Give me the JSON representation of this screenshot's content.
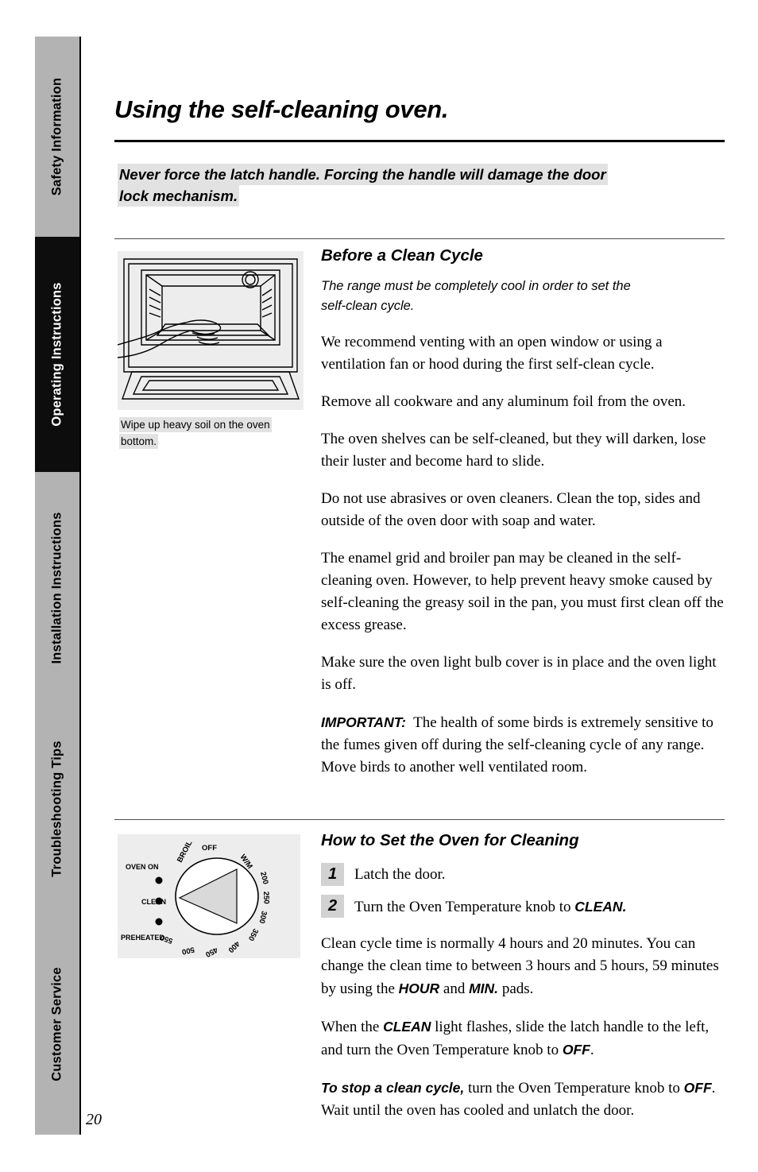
{
  "page": {
    "number": "20",
    "title": "Using the self-cleaning oven."
  },
  "sidebar": {
    "tabs": [
      {
        "label": "Safety Information",
        "active": false
      },
      {
        "label": "Operating Instructions",
        "active": true
      },
      {
        "label": "Installation Instructions",
        "active": false
      },
      {
        "label": "Troubleshooting Tips",
        "active": false
      },
      {
        "label": "Customer Service",
        "active": false
      }
    ]
  },
  "warning": {
    "line1": "Never force the latch handle. Forcing the handle will damage the door",
    "line2": "lock mechanism."
  },
  "figure_oven": {
    "caption_line1": "Wipe up heavy soil on the oven",
    "caption_line2": "bottom."
  },
  "before_clean": {
    "heading": "Before a Clean Cycle",
    "intro_line1": "The range must be completely cool in order to set the",
    "intro_line2": "self-clean cycle.",
    "paragraphs": [
      "We recommend venting with an open window or using a ventilation fan or hood during the first self-clean cycle.",
      "Remove all cookware and any aluminum foil from the oven.",
      "The oven shelves can be self-cleaned, but they will darken, lose their luster and become hard to slide.",
      "Do not use abrasives or oven cleaners. Clean the top, sides and outside of the oven door with soap and water.",
      "The enamel grid and broiler pan may be cleaned in the self-cleaning oven. However, to help prevent heavy smoke caused by self-cleaning the greasy soil in the pan, you must first clean off the excess grease.",
      "Make sure the oven light bulb cover is in place and the oven light is off."
    ],
    "important_label": "IMPORTANT:",
    "important_text": "The health of some birds is extremely sensitive to the fumes given off during the self-cleaning cycle of any range. Move birds to another well ventilated room."
  },
  "knob_figure": {
    "labels": {
      "oven_on": "OVEN ON",
      "clean": "CLEAN",
      "preheated": "PREHEATED",
      "broil": "BROIL",
      "off": "OFF",
      "warm": "W/M"
    },
    "temperatures": [
      "200",
      "250",
      "300",
      "350",
      "400",
      "450",
      "500",
      "550"
    ]
  },
  "howto": {
    "heading": "How to Set the Oven for Cleaning",
    "steps": [
      {
        "num": "1",
        "text_before": "Latch the door.",
        "bold": "",
        "text_after": ""
      },
      {
        "num": "2",
        "text_before": "Turn the Oven Temperature knob to ",
        "bold": "CLEAN.",
        "text_after": ""
      }
    ],
    "para_time_a": "Clean cycle time is normally 4 hours and 20 minutes. You can change the clean time to between 3 hours and 5 hours, 59 minutes by using the ",
    "para_time_b": "HOUR",
    "para_time_c": " and ",
    "para_time_d": "MIN.",
    "para_time_e": " pads.",
    "para_flash_a": "When the ",
    "para_flash_b": "CLEAN",
    "para_flash_c": " light flashes, slide the latch handle to the left, and turn the Oven Temperature knob to ",
    "para_flash_d": "OFF",
    "para_flash_e": ".",
    "para_stop_a": "To stop a clean cycle,",
    "para_stop_b": " turn the Oven Temperature knob to ",
    "para_stop_c": "OFF",
    "para_stop_d": ". Wait until the oven has cooled and unlatch the door."
  }
}
